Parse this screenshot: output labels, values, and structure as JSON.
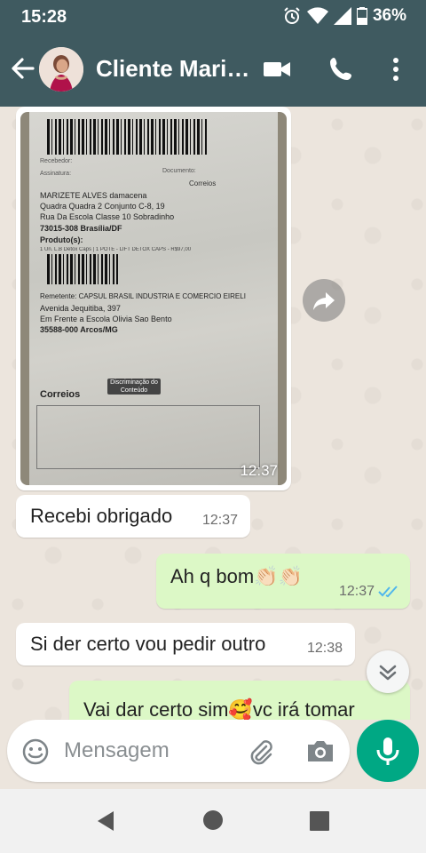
{
  "status_bar": {
    "time": "15:28",
    "battery": "36%"
  },
  "header": {
    "title": "Cliente Mari…",
    "back_icon": "arrow-back-icon",
    "video_icon": "video-call-icon",
    "call_icon": "phone-icon",
    "menu_icon": "more-vert-icon"
  },
  "messages": [
    {
      "type": "image",
      "direction": "incoming",
      "time": "12:37",
      "photo_text": {
        "recipient": "MARIZETE ALVES damacena",
        "address1": "Quadra Quadra 2 Conjunto C-8, 19",
        "address2": "Rua Da Escola Classe 10 Sobradinho",
        "city": "73015-308 Brasília/DF",
        "products_label": "Produto(s):",
        "products": "1 Un. L.B Detox Caps | 1 POTE - LIFT DETOX CAPS - R$97,00",
        "sender": "Remetente: CAPSUL BRASIL INDUSTRIA E COMERCIO EIRELI",
        "sender_addr1": "Avenida Jequitiba, 397",
        "sender_addr2": "Em Frente a Escola Olivia Sao Bento",
        "sender_city": "35588-000 Arcos/MG",
        "carrier": "Correios",
        "tag": "Discriminação do Conteúdo",
        "small_label1": "Recebedor:",
        "small_label2": "Assinatura:",
        "small_label3": "Documento:"
      }
    },
    {
      "type": "text",
      "direction": "incoming",
      "text": "Recebi obrigado",
      "time": "12:37"
    },
    {
      "type": "text",
      "direction": "outgoing",
      "text": "Ah q bom👏🏻👏🏻",
      "time": "12:37",
      "status": "read"
    },
    {
      "type": "text",
      "direction": "incoming",
      "text": "Si der certo vou pedir outro",
      "time": "12:38"
    },
    {
      "type": "text",
      "direction": "outgoing",
      "text": "Vai dar certo sim🥰vc irá tomar"
    }
  ],
  "composer": {
    "placeholder": "Mensagem",
    "emoji_icon": "emoji-icon",
    "attach_icon": "paperclip-icon",
    "camera_icon": "camera-icon",
    "mic_icon": "mic-icon"
  },
  "colors": {
    "header": "#3f5a60",
    "incoming": "#ffffff",
    "outgoing": "#dcf8c6",
    "accent": "#00a884",
    "read_ticks": "#4fb6ec"
  }
}
